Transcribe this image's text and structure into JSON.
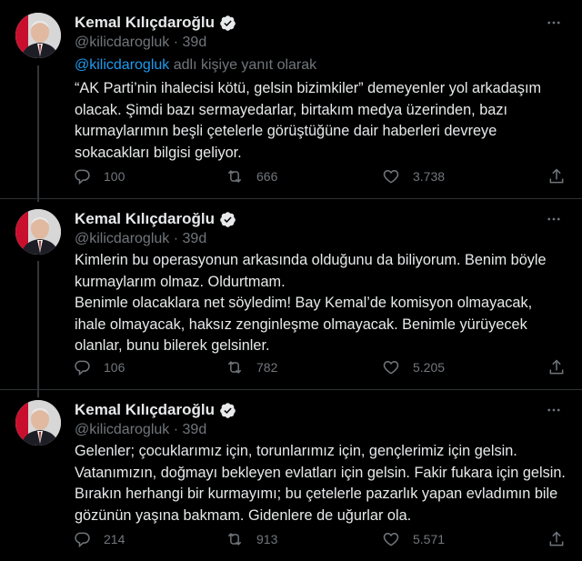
{
  "accent": "#1d9bf0",
  "tweets": [
    {
      "name": "Kemal Kılıçdaroğlu",
      "handle": "@kilicdarogluk",
      "time": "39d",
      "separator": "·",
      "reply_prefix": "@kilicdarogluk",
      "reply_suffix": "adlı kişiye yanıt olarak",
      "text": "“AK Parti’nin ihalecisi kötü, gelsin bizimkiler” demeyenler yol arkadaşım olacak. Şimdi bazı sermayedarlar, birtakım medya üzerinden, bazı kurmaylarımın beşli çetelerle görüştüğüne dair haberleri devreye sokacakları bilgisi geliyor.",
      "replies": "100",
      "retweets": "666",
      "likes": "3.738"
    },
    {
      "name": "Kemal Kılıçdaroğlu",
      "handle": "@kilicdarogluk",
      "time": "39d",
      "separator": "·",
      "text": "Kimlerin bu operasyonun arkasında olduğunu da biliyorum. Benim böyle kurmaylarım olmaz. Oldurtmam.\nBenimle olacaklara net söyledim! Bay Kemal’de komisyon olmayacak, ihale olmayacak, haksız zenginleşme olmayacak. Benimle yürüyecek olanlar, bunu bilerek gelsinler.",
      "replies": "106",
      "retweets": "782",
      "likes": "5.205"
    },
    {
      "name": "Kemal Kılıçdaroğlu",
      "handle": "@kilicdarogluk",
      "time": "39d",
      "separator": "·",
      "text": "Gelenler; çocuklarımız için, torunlarımız için, gençlerimiz için gelsin. Vatanımızın, doğmayı bekleyen evlatları için gelsin. Fakir fukara için gelsin. Bırakın herhangi bir kurmayımı; bu çetelerle pazarlık yapan evladımın bile gözünün yaşına bakmam. Gidenlere de uğurlar ola.",
      "replies": "214",
      "retweets": "913",
      "likes": "5.571"
    }
  ],
  "icons": {
    "more": "more-icon",
    "verified": "verified-badge-icon",
    "reply": "reply-icon",
    "retweet": "retweet-icon",
    "like": "heart-icon",
    "share": "share-icon"
  }
}
